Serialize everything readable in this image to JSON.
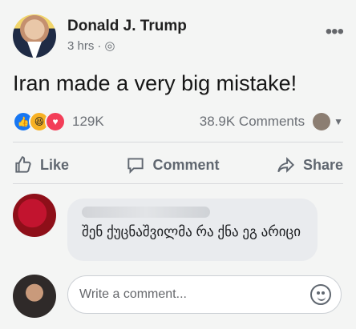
{
  "post": {
    "author": "Donald J. Trump",
    "time": "3 hrs",
    "visibility_icon": "globe-icon",
    "menu_icon": "more-icon",
    "text": "Iran made a very big mistake!"
  },
  "stats": {
    "reaction_icons": [
      "like-icon",
      "haha-icon",
      "love-icon"
    ],
    "reaction_count": "129K",
    "comments_count": "38.9K Comments"
  },
  "actions": {
    "like": "Like",
    "comment": "Comment",
    "share": "Share"
  },
  "comment": {
    "text": "შენ ქუცნაშვილმა რა ქნა ეგ არიცი"
  },
  "composer": {
    "placeholder": "Write a comment..."
  }
}
